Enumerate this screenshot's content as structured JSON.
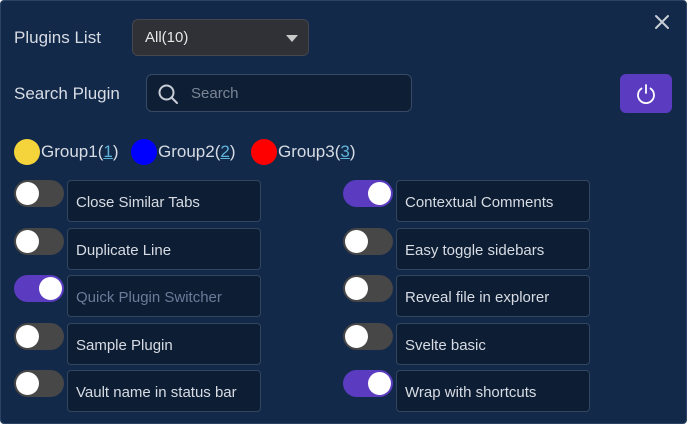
{
  "header": {
    "plugins_list_label": "Plugins List",
    "filter_selected": "All(10)",
    "search_label": "Search Plugin",
    "search_placeholder": "Search",
    "search_value": ""
  },
  "groups": [
    {
      "name": "Group1",
      "count": "1",
      "color": "#f5d33b"
    },
    {
      "name": "Group2",
      "count": "2",
      "color": "#0000ff"
    },
    {
      "name": "Group3",
      "count": "3",
      "color": "#ff0000"
    }
  ],
  "plugins_left": [
    {
      "label": "Close Similar Tabs",
      "enabled": false,
      "dimmed": false
    },
    {
      "label": "Duplicate Line",
      "enabled": false,
      "dimmed": false
    },
    {
      "label": "Quick Plugin Switcher",
      "enabled": true,
      "dimmed": true
    },
    {
      "label": "Sample Plugin",
      "enabled": false,
      "dimmed": false
    },
    {
      "label": "Vault name in status bar",
      "enabled": false,
      "dimmed": false
    }
  ],
  "plugins_right": [
    {
      "label": "Contextual Comments",
      "enabled": true,
      "dimmed": false
    },
    {
      "label": "Easy toggle sidebars",
      "enabled": false,
      "dimmed": false
    },
    {
      "label": "Reveal file in explorer",
      "enabled": false,
      "dimmed": false
    },
    {
      "label": "Svelte basic",
      "enabled": false,
      "dimmed": false
    },
    {
      "label": "Wrap with shortcuts",
      "enabled": true,
      "dimmed": false
    }
  ],
  "icons": {
    "close": "close-icon",
    "search": "search-icon",
    "power": "power-icon",
    "caret": "chevron-down-icon"
  },
  "colors": {
    "background": "#13294a",
    "accent": "#5b3cc0",
    "toggle_off": "#474747",
    "link": "#5fb3d9"
  }
}
